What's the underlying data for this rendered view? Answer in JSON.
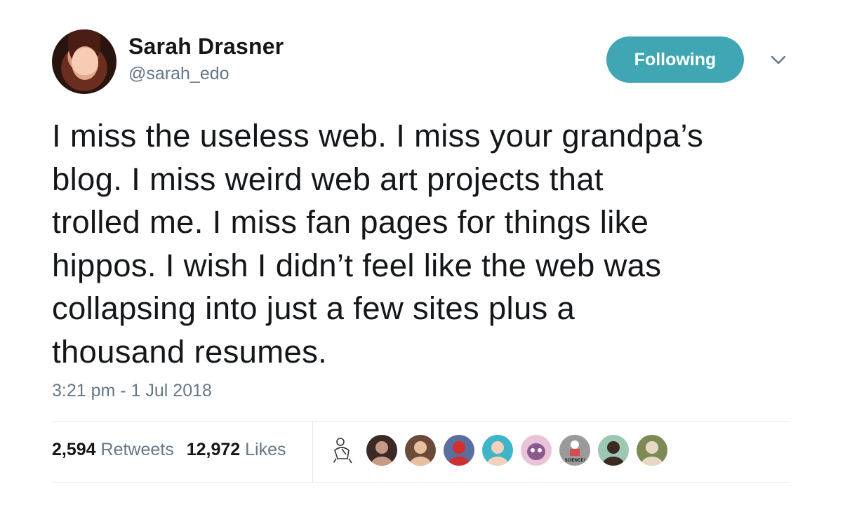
{
  "author": {
    "name": "Sarah Drasner",
    "handle": "@sarah_edo"
  },
  "follow_button": {
    "label": "Following",
    "color": "#40a6b3"
  },
  "tweet": {
    "text": "I miss the useless web. I miss your grandpa’s\nblog. I miss weird web art projects that\ntrolled me. I miss fan pages for things like\nhippos. I wish I didn’t feel like the web was\ncollapsing into just a few sites plus a\nthousand resumes."
  },
  "timestamp": "3:21 pm - 1 Jul 2018",
  "stats": {
    "retweets_count": "2,594",
    "retweets_label": "Retweets",
    "likes_count": "12,972",
    "likes_label": "Likes"
  },
  "likers": [
    {
      "icon": "sketch-avatar",
      "colors": [
        "#ffffff",
        "#333333"
      ]
    },
    {
      "icon": "person-avatar",
      "colors": [
        "#3b2a26",
        "#c79a86"
      ]
    },
    {
      "icon": "person-avatar",
      "colors": [
        "#6c4a3a",
        "#e8c0a0"
      ]
    },
    {
      "icon": "person-avatar",
      "colors": [
        "#5b6f9e",
        "#d0302f"
      ]
    },
    {
      "icon": "person-avatar",
      "colors": [
        "#3fb6c8",
        "#f3d1bd"
      ]
    },
    {
      "icon": "cartoon-avatar",
      "colors": [
        "#e9c4d8",
        "#8b5a8c"
      ]
    },
    {
      "icon": "science-avatar",
      "colors": [
        "#9a9a9a",
        "#d94a4a"
      ],
      "text": "SCIENCE!"
    },
    {
      "icon": "person-avatar",
      "colors": [
        "#9cc7b2",
        "#3b2a22"
      ]
    },
    {
      "icon": "person-avatar",
      "colors": [
        "#7c8a55",
        "#e7d9c5"
      ]
    }
  ]
}
